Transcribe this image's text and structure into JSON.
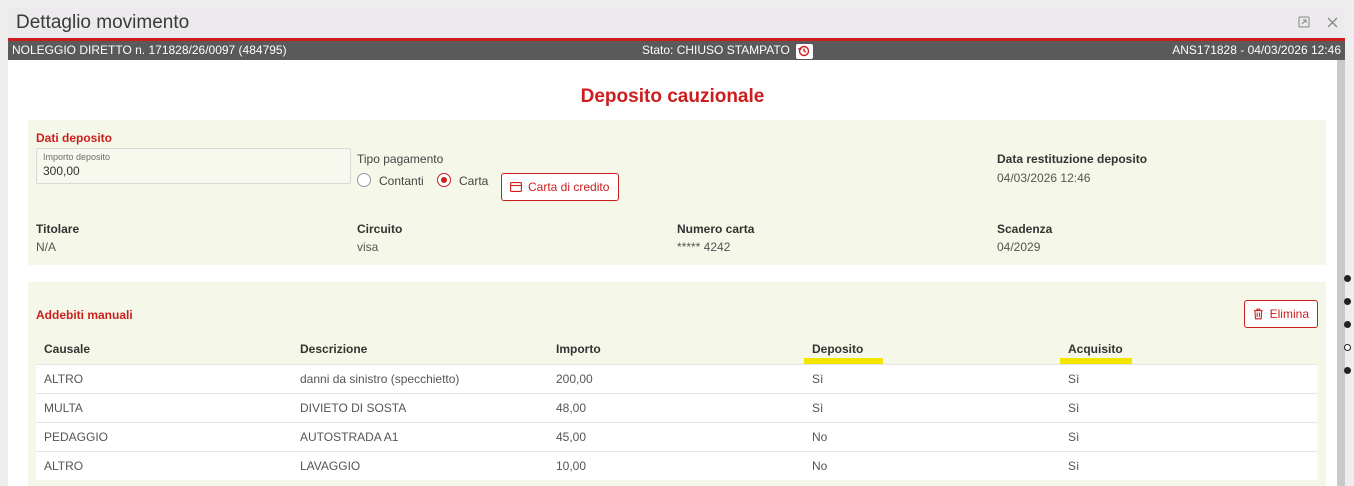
{
  "window": {
    "title": "Dettaglio movimento"
  },
  "infobar": {
    "left": "NOLEGGIO DIRETTO n. 171828/26/0097 (484795)",
    "status": "Stato: CHIUSO STAMPATO",
    "right": "ANS171828 - 04/03/2026 12:46"
  },
  "heading": "Deposito cauzionale",
  "deposit": {
    "section_title": "Dati deposito",
    "amount_label": "Importo deposito",
    "amount_value": "300,00",
    "payment_type_label": "Tipo pagamento",
    "options": [
      "Contanti",
      "Carta"
    ],
    "selected_option": "Carta",
    "card_button": "Carta di credito",
    "return_date_label": "Data restituzione deposito",
    "return_date_value": "04/03/2026 12:46",
    "holder_label": "Titolare",
    "holder_value": "N/A",
    "circuit_label": "Circuito",
    "circuit_value": "visa",
    "card_number_label": "Numero carta",
    "card_number_value": "***** 4242",
    "expiry_label": "Scadenza",
    "expiry_value": "04/2029"
  },
  "charges": {
    "section_title": "Addebiti manuali",
    "delete_button": "Elimina",
    "columns": [
      "Causale",
      "Descrizione",
      "Importo",
      "Deposito",
      "Acquisito"
    ],
    "rows": [
      [
        "ALTRO",
        "danni da sinistro (specchietto)",
        "200,00",
        "Sì",
        "Sì"
      ],
      [
        "MULTA",
        "DIVIETO DI SOSTA",
        "48,00",
        "Sì",
        "Sì"
      ],
      [
        "PEDAGGIO",
        "AUTOSTRADA A1",
        "45,00",
        "No",
        "Sì"
      ],
      [
        "ALTRO",
        "LAVAGGIO",
        "10,00",
        "No",
        "Sì"
      ]
    ]
  },
  "colors": {
    "accent": "#cc1e1e",
    "panel": "#f5f8e8",
    "infobar": "#5a5a5a",
    "highlight": "#f2e600"
  }
}
